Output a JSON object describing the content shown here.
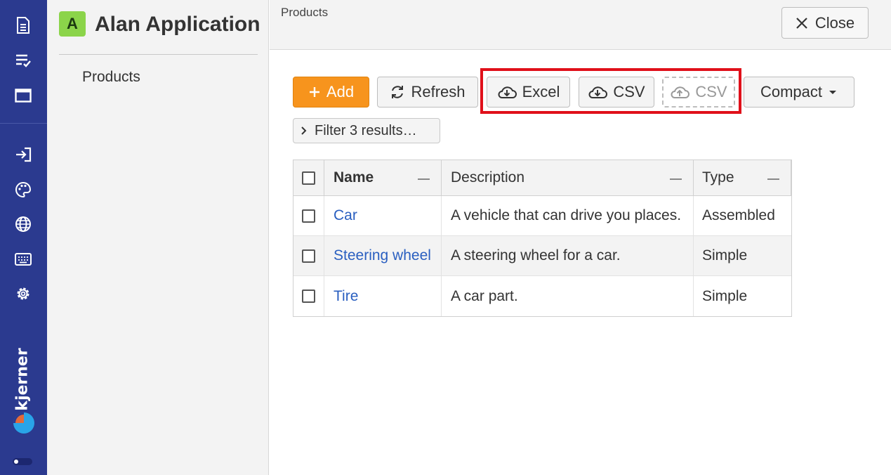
{
  "rail": {
    "icons_top": [
      "document-icon",
      "checklist-icon",
      "window-icon"
    ],
    "icons_bottom": [
      "login-icon",
      "palette-icon",
      "globe-icon",
      "keyboard-icon",
      "gear-icon"
    ],
    "brand": "kjerner"
  },
  "nav": {
    "badge": "A",
    "app_title": "Alan Application",
    "items": [
      {
        "label": "Products"
      }
    ]
  },
  "header": {
    "breadcrumb": "Products",
    "close_label": "Close"
  },
  "toolbar": {
    "add_label": "Add",
    "refresh_label": "Refresh",
    "excel_label": "Excel",
    "csv_download_label": "CSV",
    "csv_upload_label": "CSV",
    "view_label": "Compact"
  },
  "filter": {
    "label": "Filter 3 results…"
  },
  "table": {
    "columns": [
      "Name",
      "Description",
      "Type"
    ],
    "rows": [
      {
        "name": "Car",
        "description": "A vehicle that can drive you places.",
        "type": "Assembled"
      },
      {
        "name": "Steering wheel",
        "description": "A steering wheel for a car.",
        "type": "Simple"
      },
      {
        "name": "Tire",
        "description": "A car part.",
        "type": "Simple"
      }
    ]
  },
  "colors": {
    "rail": "#2b3a8f",
    "accent": "#f7941d",
    "badge": "#8bd44a",
    "link": "#2a5fc0",
    "highlight": "#e0101a"
  }
}
